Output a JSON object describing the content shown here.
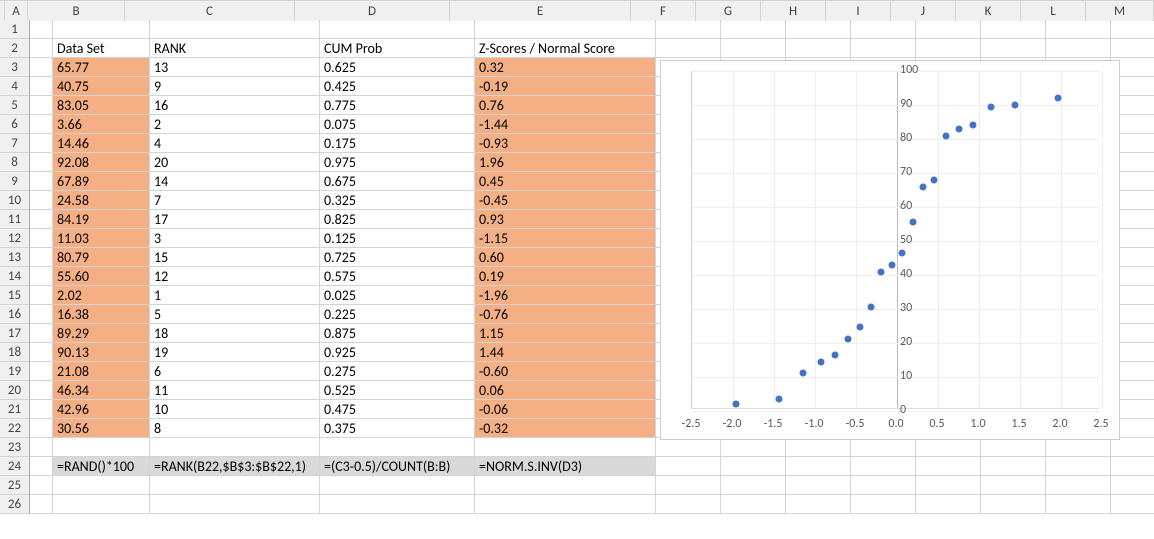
{
  "columns": [
    {
      "label": "A",
      "width": 23
    },
    {
      "label": "B",
      "width": 97
    },
    {
      "label": "C",
      "width": 170
    },
    {
      "label": "D",
      "width": 155
    },
    {
      "label": "E",
      "width": 181
    },
    {
      "label": "F",
      "width": 65
    },
    {
      "label": "G",
      "width": 65
    },
    {
      "label": "H",
      "width": 65
    },
    {
      "label": "I",
      "width": 65
    },
    {
      "label": "J",
      "width": 65
    },
    {
      "label": "K",
      "width": 65
    },
    {
      "label": "L",
      "width": 65
    },
    {
      "label": "M",
      "width": 68
    }
  ],
  "row_count": 26,
  "headers": {
    "B": "Data Set",
    "C": "RANK",
    "D": "CUM Prob",
    "E": "Z-Scores / Normal Score"
  },
  "data_rows": [
    {
      "B": "65.77",
      "C": "13",
      "D": "0.625",
      "E": "0.32"
    },
    {
      "B": "40.75",
      "C": "9",
      "D": "0.425",
      "E": "-0.19"
    },
    {
      "B": "83.05",
      "C": "16",
      "D": "0.775",
      "E": "0.76"
    },
    {
      "B": "3.66",
      "C": "2",
      "D": "0.075",
      "E": "-1.44"
    },
    {
      "B": "14.46",
      "C": "4",
      "D": "0.175",
      "E": "-0.93"
    },
    {
      "B": "92.08",
      "C": "20",
      "D": "0.975",
      "E": "1.96"
    },
    {
      "B": "67.89",
      "C": "14",
      "D": "0.675",
      "E": "0.45"
    },
    {
      "B": "24.58",
      "C": "7",
      "D": "0.325",
      "E": "-0.45"
    },
    {
      "B": "84.19",
      "C": "17",
      "D": "0.825",
      "E": "0.93"
    },
    {
      "B": "11.03",
      "C": "3",
      "D": "0.125",
      "E": "-1.15"
    },
    {
      "B": "80.79",
      "C": "15",
      "D": "0.725",
      "E": "0.60"
    },
    {
      "B": "55.60",
      "C": "12",
      "D": "0.575",
      "E": "0.19"
    },
    {
      "B": "2.02",
      "C": "1",
      "D": "0.025",
      "E": "-1.96"
    },
    {
      "B": "16.38",
      "C": "5",
      "D": "0.225",
      "E": "-0.76"
    },
    {
      "B": "89.29",
      "C": "18",
      "D": "0.875",
      "E": "1.15"
    },
    {
      "B": "90.13",
      "C": "19",
      "D": "0.925",
      "E": "1.44"
    },
    {
      "B": "21.08",
      "C": "6",
      "D": "0.275",
      "E": "-0.60"
    },
    {
      "B": "46.34",
      "C": "11",
      "D": "0.525",
      "E": "0.06"
    },
    {
      "B": "42.96",
      "C": "10",
      "D": "0.475",
      "E": "-0.06"
    },
    {
      "B": "30.56",
      "C": "8",
      "D": "0.375",
      "E": "-0.32"
    }
  ],
  "formula_row": {
    "B": "=RAND()*100",
    "C": "=RANK(B22,$B$3:$B$22,1)",
    "D": "=(C3-0.5)/COUNT(B:B)",
    "E": "=NORM.S.INV(D3)"
  },
  "chart_data": {
    "type": "scatter",
    "xlim": [
      -2.5,
      2.5
    ],
    "ylim": [
      0,
      100
    ],
    "x_ticks": [
      -2.5,
      -2.0,
      -1.5,
      -1.0,
      -0.5,
      0.0,
      0.5,
      1.0,
      1.5,
      2.0,
      2.5
    ],
    "y_ticks": [
      0,
      10,
      20,
      30,
      40,
      50,
      60,
      70,
      80,
      90,
      100
    ],
    "series": [
      {
        "name": "",
        "points": [
          {
            "x": 0.32,
            "y": 65.77
          },
          {
            "x": -0.19,
            "y": 40.75
          },
          {
            "x": 0.76,
            "y": 83.05
          },
          {
            "x": -1.44,
            "y": 3.66
          },
          {
            "x": -0.93,
            "y": 14.46
          },
          {
            "x": 1.96,
            "y": 92.08
          },
          {
            "x": 0.45,
            "y": 67.89
          },
          {
            "x": -0.45,
            "y": 24.58
          },
          {
            "x": 0.93,
            "y": 84.19
          },
          {
            "x": -1.15,
            "y": 11.03
          },
          {
            "x": 0.6,
            "y": 80.79
          },
          {
            "x": 0.19,
            "y": 55.6
          },
          {
            "x": -1.96,
            "y": 2.02
          },
          {
            "x": -0.76,
            "y": 16.38
          },
          {
            "x": 1.15,
            "y": 89.29
          },
          {
            "x": 1.44,
            "y": 90.13
          },
          {
            "x": -0.6,
            "y": 21.08
          },
          {
            "x": 0.06,
            "y": 46.34
          },
          {
            "x": -0.06,
            "y": 42.96
          },
          {
            "x": -0.32,
            "y": 30.56
          }
        ]
      }
    ]
  }
}
